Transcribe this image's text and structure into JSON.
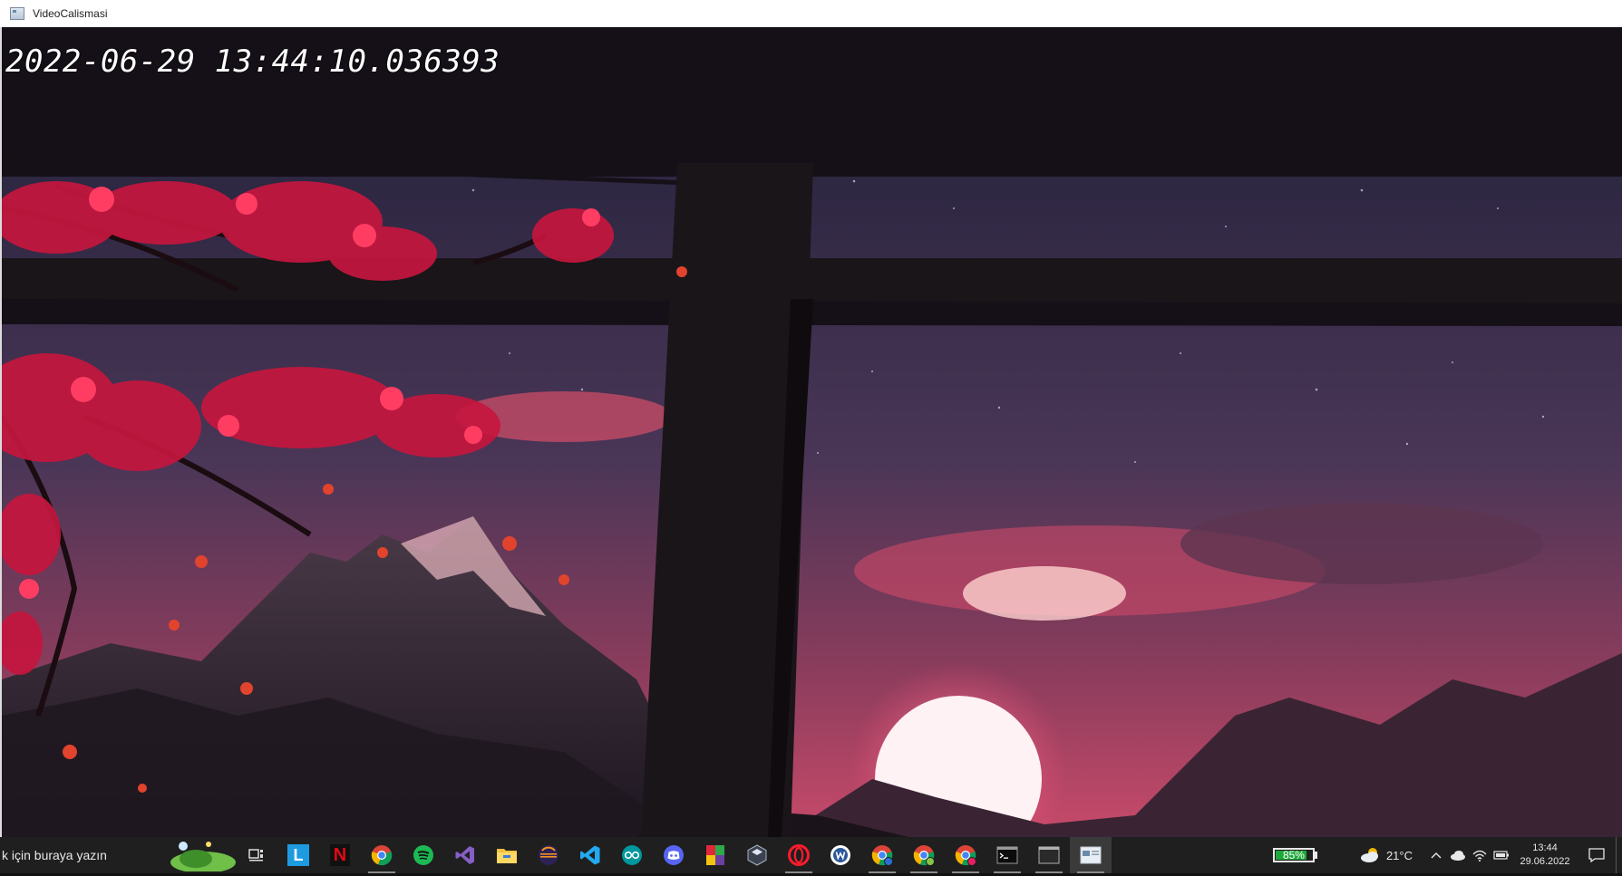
{
  "window": {
    "title": "VideoCalismasi"
  },
  "video": {
    "timestamp": "2022-06-29 13:44:10.036393"
  },
  "taskbar": {
    "search_text": "k için buraya yazın",
    "apps": [
      {
        "name": "task-view-icon"
      },
      {
        "name": "l-app-icon",
        "letter": "L"
      },
      {
        "name": "netflix-icon",
        "letter": "N"
      },
      {
        "name": "chrome-icon"
      },
      {
        "name": "spotify-icon"
      },
      {
        "name": "visual-studio-icon"
      },
      {
        "name": "file-explorer-icon"
      },
      {
        "name": "eclipse-icon"
      },
      {
        "name": "vscode-icon"
      },
      {
        "name": "arduino-icon"
      },
      {
        "name": "discord-icon"
      },
      {
        "name": "winrar-icon"
      },
      {
        "name": "unity-icon"
      },
      {
        "name": "opera-icon"
      },
      {
        "name": "word-icon"
      },
      {
        "name": "chrome-profile-1-icon"
      },
      {
        "name": "chrome-profile-2-icon"
      },
      {
        "name": "chrome-profile-3-icon"
      },
      {
        "name": "terminal-icon"
      },
      {
        "name": "console-window-icon"
      },
      {
        "name": "video-window-icon"
      }
    ],
    "battery_percent": "85%",
    "battery_level": 0.85,
    "temperature": "21°C",
    "clock_time": "13:44",
    "clock_date": "29.06.2022"
  }
}
